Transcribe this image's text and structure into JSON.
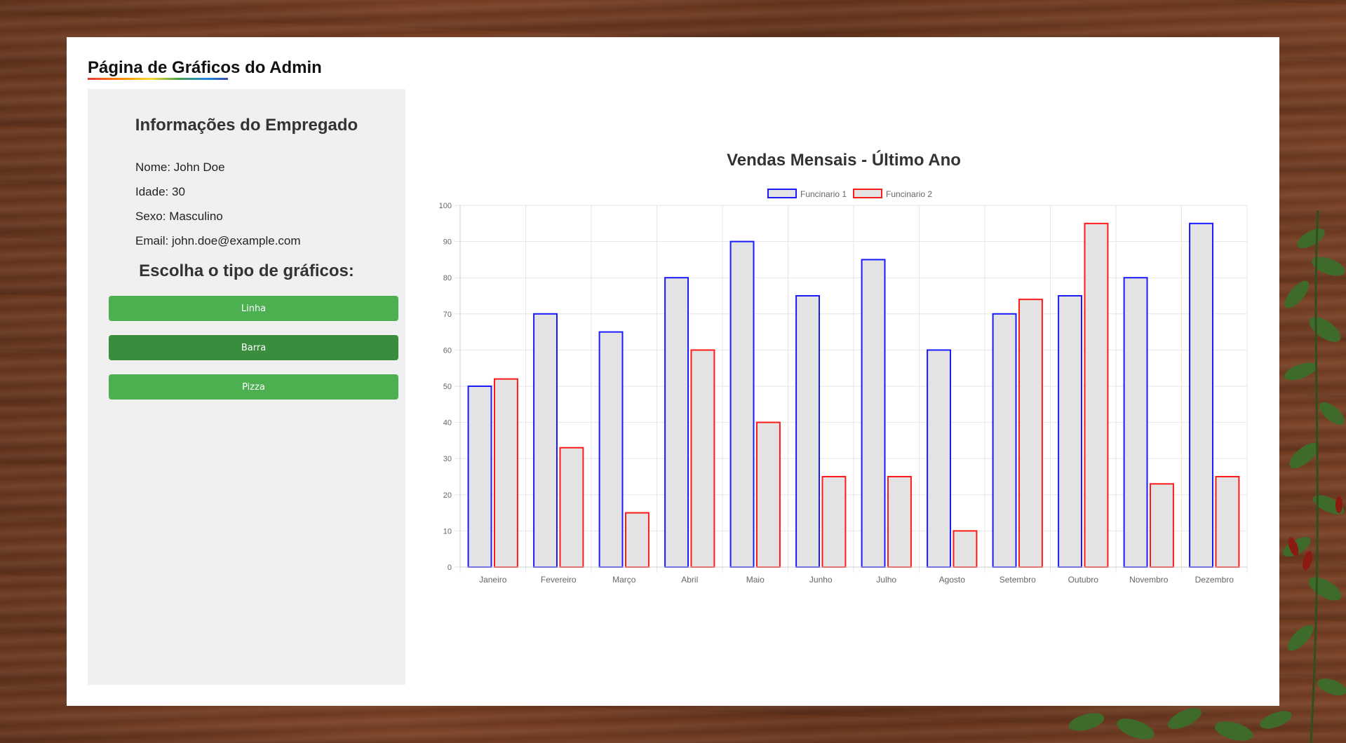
{
  "page": {
    "title": "Página de Gráficos do Admin"
  },
  "employee": {
    "heading": "Informações do Empregado",
    "name": "Nome: John Doe",
    "age": "Idade: 30",
    "sex": "Sexo: Masculino",
    "email": "Email: john.doe@example.com"
  },
  "chart_picker": {
    "heading": "Escolha o tipo de gráficos:",
    "buttons": {
      "line": "Linha",
      "bar": "Barra",
      "pie": "Pizza"
    },
    "selected": "Barra"
  },
  "colors": {
    "button_green": "#4caf50",
    "button_green_active": "#388e3c",
    "sidebar_bg": "#f0f0f0",
    "series1_border": "#1a1aff",
    "series2_border": "#ff1a1a",
    "bar_fill": "#e3e3e3"
  },
  "chart_data": {
    "type": "bar",
    "title": "Vendas Mensais - Último Ano",
    "xlabel": "",
    "ylabel": "",
    "ylim": [
      0,
      100
    ],
    "yticks": [
      0,
      10,
      20,
      30,
      40,
      50,
      60,
      70,
      80,
      90,
      100
    ],
    "grid": true,
    "legend_position": "top",
    "categories": [
      "Janeiro",
      "Fevereiro",
      "Março",
      "Abril",
      "Maio",
      "Junho",
      "Julho",
      "Agosto",
      "Setembro",
      "Outubro",
      "Novembro",
      "Dezembro"
    ],
    "series": [
      {
        "name": "Funcinario 1",
        "color": "#1a1aff",
        "values": [
          50,
          70,
          65,
          80,
          90,
          75,
          85,
          60,
          70,
          75,
          80,
          95
        ]
      },
      {
        "name": "Funcinario 2",
        "color": "#ff1a1a",
        "values": [
          52,
          33,
          15,
          60,
          40,
          25,
          25,
          10,
          74,
          95,
          23,
          25
        ]
      }
    ]
  }
}
